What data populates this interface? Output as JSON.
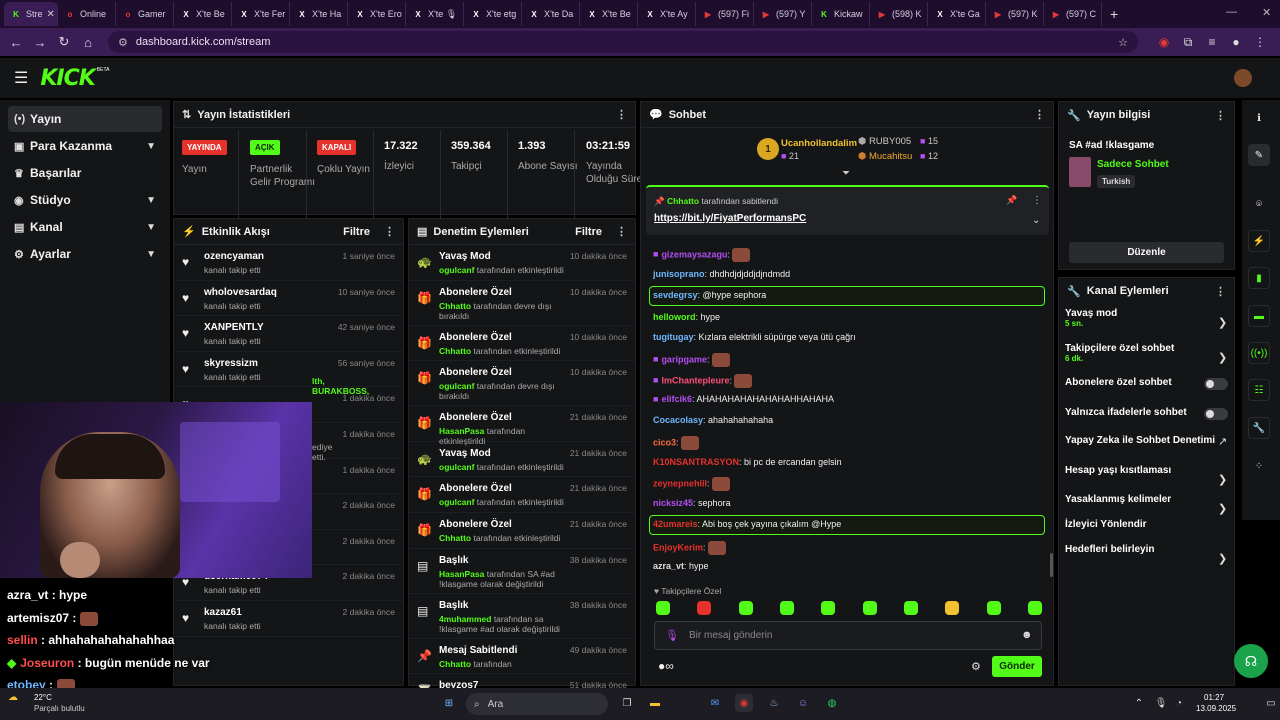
{
  "browser": {
    "tabs": [
      {
        "label": "Stre",
        "icon": "K",
        "color": "#53fc18"
      },
      {
        "label": "Online",
        "icon": "o",
        "color": "#e53935"
      },
      {
        "label": "Gamer",
        "icon": "o",
        "color": "#e53935"
      },
      {
        "label": "X'te Be",
        "icon": "X",
        "color": "#ffffff"
      },
      {
        "label": "X'te Fer",
        "icon": "X",
        "color": "#ffffff"
      },
      {
        "label": "X'te Ha",
        "icon": "X",
        "color": "#ffffff"
      },
      {
        "label": "X'te Ero",
        "icon": "X",
        "color": "#ffffff"
      },
      {
        "label": "X'te 🎙",
        "icon": "X",
        "color": "#ffffff"
      },
      {
        "label": "X'te etg",
        "icon": "X",
        "color": "#ffffff"
      },
      {
        "label": "X'te Da",
        "icon": "X",
        "color": "#ffffff"
      },
      {
        "label": "X'te Be",
        "icon": "X",
        "color": "#ffffff"
      },
      {
        "label": "X'te Ay",
        "icon": "X",
        "color": "#ffffff"
      },
      {
        "label": "(597) Fi",
        "icon": "▶",
        "color": "#e53935"
      },
      {
        "label": "(597) Y",
        "icon": "▶",
        "color": "#e53935"
      },
      {
        "label": "Kickaw",
        "icon": "K",
        "color": "#53fc18"
      },
      {
        "label": "(598) K",
        "icon": "▶",
        "color": "#e53935"
      },
      {
        "label": "X'te Ga",
        "icon": "X",
        "color": "#ffffff"
      },
      {
        "label": "(597) K",
        "icon": "▶",
        "color": "#e53935"
      },
      {
        "label": "(597) C",
        "icon": "▶",
        "color": "#e53935"
      }
    ],
    "url": "dashboard.kick.com/stream"
  },
  "header": {
    "logo": "KICK",
    "beta": "BETA"
  },
  "sidebar": {
    "items": [
      {
        "label": "Yayın",
        "icon": "(•)"
      },
      {
        "label": "Para Kazanma",
        "icon": "▣"
      },
      {
        "label": "Başarılar",
        "icon": "🏆"
      },
      {
        "label": "Stüdyo",
        "icon": "◉"
      },
      {
        "label": "Kanal",
        "icon": "▤"
      },
      {
        "label": "Ayarlar",
        "icon": "⚙"
      }
    ]
  },
  "stats": {
    "title": "Yayın İstatistikleri",
    "yayin_badge": "YAYINDA",
    "yayin_label": "Yayın",
    "partner_badge": "AÇIK",
    "partner_label": "Partnerlik Gelir Programı",
    "coklu_badge": "KAPALI",
    "coklu_label": "Çoklu Yayın",
    "izleyici_val": "17.322",
    "izleyici_label": "İzleyici",
    "takipci_val": "359.364",
    "takipci_label": "Takipçi",
    "abone_val": "1.393",
    "abone_label": "Abone Sayısı",
    "sure_val": "03:21:59",
    "sure_label": "Yayında Olduğu Süre"
  },
  "activity": {
    "title": "Etkinlik Akışı",
    "filter": "Filtre",
    "rows": [
      {
        "name": "ozencyaman",
        "sub": "kanalı takip etti",
        "time": "1 saniye önce"
      },
      {
        "name": "wholovesardaq",
        "sub": "kanalı takip etti",
        "time": "10 saniye önce"
      },
      {
        "name": "XANPENTLY",
        "sub": "kanalı takip etti",
        "time": "42 saniye önce"
      },
      {
        "name": "skyressizm",
        "sub": "kanalı takip etti",
        "time": "56 saniye önce"
      },
      {
        "name": "",
        "sub": "",
        "time": "1 dakika önce"
      },
      {
        "name": "",
        "sub": "",
        "time": "1 dakika önce"
      },
      {
        "name": "",
        "sub": "",
        "time": "1 dakika önce"
      },
      {
        "name": "",
        "sub": "",
        "time": "2 dakika önce"
      },
      {
        "name": "",
        "sub": "kanalı takip etti",
        "time": "2 dakika önce"
      },
      {
        "name": "username974",
        "sub": "kanalı takip etti",
        "time": "2 dakika önce"
      },
      {
        "name": "kazaz61",
        "sub": "kanalı takip etti",
        "time": "2 dakika önce"
      }
    ],
    "gift_fragment": "lth, BURAKBOSS,",
    "gift_fragment2": "ediye etti."
  },
  "moderation": {
    "title": "Denetim Eylemleri",
    "filter": "Filtre",
    "rows": [
      {
        "icon": "🐢",
        "title": "Yavaş Mod",
        "user": "ogulcanf",
        "action": "tarafından etkinleştirildi",
        "time": "10 dakika önce"
      },
      {
        "icon": "🎁",
        "title": "Abonelere Özel",
        "user": "Chhatto",
        "action": "tarafından devre dışı bırakıldı",
        "time": "10 dakika önce"
      },
      {
        "icon": "🎁",
        "title": "Abonelere Özel",
        "user": "Chhatto",
        "action": "tarafından etkinleştirildi",
        "time": "10 dakika önce"
      },
      {
        "icon": "🎁",
        "title": "Abonelere Özel",
        "user": "ogulcanf",
        "action": "tarafından devre dışı bırakıldı",
        "time": "10 dakika önce"
      },
      {
        "icon": "🎁",
        "title": "Abonelere Özel",
        "user": "HasanPasa",
        "action": "tarafından etkinleştirildi",
        "time": "21 dakika önce"
      },
      {
        "icon": "🐢",
        "title": "Yavaş Mod",
        "user": "ogulcanf",
        "action": "tarafından etkinleştirildi",
        "time": "21 dakika önce"
      },
      {
        "icon": "🎁",
        "title": "Abonelere Özel",
        "user": "ogulcanf",
        "action": "tarafından etkinleştirildi",
        "time": "21 dakika önce"
      },
      {
        "icon": "🎁",
        "title": "Abonelere Özel",
        "user": "Chhatto",
        "action": "tarafından etkinleştirildi",
        "time": "21 dakika önce"
      },
      {
        "icon": "▤",
        "title": "Başlık",
        "user": "HasanPasa",
        "action": "tarafından SA #ad !klasgame olarak değiştirildi",
        "time": "38 dakika önce"
      },
      {
        "icon": "▤",
        "title": "Başlık",
        "user": "4muhammed",
        "action": "tarafından sa !klasgame #ad olarak değiştirildi",
        "time": "38 dakika önce"
      },
      {
        "icon": "📌",
        "title": "Mesaj Sabitlendi",
        "user": "Chhatto",
        "action": "tarafından",
        "time": "49 dakika önce"
      },
      {
        "icon": "🍸",
        "title": "beyzos7",
        "user": "",
        "action": "",
        "time": "51 dakika önce"
      }
    ]
  },
  "chat": {
    "title": "Sohbet",
    "top": [
      {
        "rank": "1",
        "name": "Ucanhollandalim",
        "count": "21"
      },
      {
        "name": "RUBY005",
        "count": "15"
      },
      {
        "name": "Mucahitsu",
        "count": "12"
      }
    ],
    "pinned_by": "Chhatto",
    "pinned_text": "tarafından sabitlendi",
    "pinned_link": "https://bit.ly/FiyatPerformansPC",
    "messages": [
      {
        "user": "gizemaysazagu",
        "color": "#b44ef0",
        "text": ""
      },
      {
        "user": "junisoprano",
        "color": "#6fb7ff",
        "text": "dhdhdjdjddjdjndmdd"
      },
      {
        "user": "sevdegrsy",
        "color": "#6fb7ff",
        "text": "@hype sephora"
      },
      {
        "user": "helloword",
        "color": "#53fc18",
        "text": "hype"
      },
      {
        "user": "tugitugay",
        "color": "#6fb7ff",
        "text": "Kızlara elektrikli süpürge veya ütü çağrı"
      },
      {
        "user": "garipgame",
        "color": "#b44ef0",
        "text": ""
      },
      {
        "user": "ImChantepleure",
        "color": "#ff4d7a",
        "text": ""
      },
      {
        "user": "elifcik6",
        "color": "#b44ef0",
        "text": "AHAHAHAHAHAHAHAHHAHAHA"
      },
      {
        "user": "Cocacolasy",
        "color": "#6fb7ff",
        "text": "ahahahahahaha"
      },
      {
        "user": "cico3",
        "color": "#ff6b3d",
        "text": ""
      },
      {
        "user": "K10NSANTRASYON",
        "color": "#e5322d",
        "text": "bi pc de ercandan gelsin"
      },
      {
        "user": "zeynepnehiil",
        "color": "#e5322d",
        "text": ""
      },
      {
        "user": "nicksiz45",
        "color": "#b44ef0",
        "text": "sephora"
      },
      {
        "user": "42umareis",
        "color": "#e5322d",
        "text": "Abi boş çek yayına çıkalım @Hype"
      },
      {
        "user": "EnjoyKerim",
        "color": "#e5322d",
        "text": ""
      },
      {
        "user": "azra_vt",
        "color": "#dddddd",
        "text": "hype"
      }
    ],
    "followers_only": "Takipçilere Özel",
    "input_placeholder": "Bir mesaj gönderin",
    "send": "Gönder"
  },
  "streaminfo": {
    "title": "Yayın bilgisi",
    "stream_title": "SA #ad !klasgame",
    "category": "Sadece Sohbet",
    "tag": "Turkish",
    "edit": "Düzenle"
  },
  "channel_actions": {
    "title": "Kanal Eylemleri",
    "rows": [
      {
        "label": "Yavaş mod",
        "sub": "5 sn.",
        "control": "chevron"
      },
      {
        "label": "Takipçilere özel sohbet",
        "sub": "6 dk.",
        "control": "chevron"
      },
      {
        "label": "Abonelere özel sohbet",
        "sub": "",
        "control": "toggle"
      },
      {
        "label": "Yalnızca ifadelerle sohbet",
        "sub": "",
        "control": "toggle"
      },
      {
        "label": "Yapay Zeka ile Sohbet Denetimi",
        "sub": "",
        "control": "external"
      },
      {
        "label": "Hesap yaşı kısıtlaması",
        "sub": "",
        "control": "chevron"
      },
      {
        "label": "Yasaklanmış kelimeler",
        "sub": "",
        "control": "chevron"
      },
      {
        "label": "İzleyici Yönlendir",
        "sub": "",
        "control": "none"
      },
      {
        "label": "Hedefleri belirleyin",
        "sub": "",
        "control": "chevron"
      }
    ]
  },
  "overlay": {
    "lines": [
      {
        "user": "azra_vt",
        "text": " : hype",
        "color": "#ffffff"
      },
      {
        "user": "artemisz07",
        "text": " :",
        "color": "#ffffff"
      },
      {
        "user": "sellin",
        "text": " : ahhahahahahahahhaa",
        "color": "#ff4d4d"
      },
      {
        "user": "Joseuron",
        "text": " : bugün menüde ne var",
        "color": "#ff4d4d"
      },
      {
        "user": "etobey",
        "text": " :",
        "color": "#6fb7ff"
      }
    ]
  },
  "taskbar": {
    "weather_temp": "22°C",
    "weather_desc": "Parçalı bulutlu",
    "search": "Ara",
    "time": "01:27",
    "date": "13.09.2025"
  },
  "colors": {
    "accent": "#53fc18",
    "live": "#e5322d",
    "panel": "#141517"
  }
}
